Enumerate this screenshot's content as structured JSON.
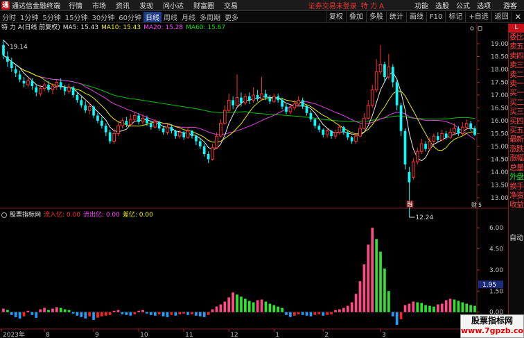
{
  "menubar": {
    "logo": "通",
    "app_title": "通达信金融终端",
    "items": [
      "行情",
      "市场",
      "资讯",
      "发现",
      "问小达",
      "财富圈",
      "交易"
    ],
    "status": "证券交易未登录",
    "stock_name": "特 力 A",
    "right_items": [
      "功能",
      "选股",
      "公式",
      "选项",
      "游客"
    ]
  },
  "toolbar": {
    "periods": [
      "分时",
      "1分钟",
      "5分钟",
      "15分钟",
      "30分钟",
      "60分钟",
      "日线",
      "周线",
      "月线",
      "多周期",
      "更多"
    ],
    "active_period": "日线",
    "tools": [
      "复权",
      "叠加",
      "多股",
      "统计",
      "画线",
      "F10",
      "标记",
      "+自选",
      "返回"
    ],
    "close": "✕"
  },
  "main_chart": {
    "title": "特 力 A(日线 前复权)",
    "ma5": "MA5: 15.43",
    "ma10": "MA10: 15.43",
    "ma20": "MA20: 15.28",
    "ma60": "MA60: 15.67",
    "high_label": "19.14",
    "low_label": "12.24",
    "axis_ticks": [
      "19.00",
      "18.50",
      "18.00",
      "17.50",
      "17.00",
      "16.50",
      "16.00",
      "15.50",
      "15.00",
      "14.50",
      "14.00",
      "13.50",
      "13.00"
    ],
    "badge_liang": "融",
    "badge_cai": "财",
    "badge_num": "5"
  },
  "indicator": {
    "name": "股票指标网",
    "in_label": "流入亿: 0.00",
    "out_label": "流出亿: 0.00",
    "diff_label": "差亿: 0.00",
    "axis_ticks": [
      "6.00",
      "4.50",
      "3.00",
      "1.50",
      "0.00"
    ],
    "current_value": "1.95"
  },
  "x_axis": {
    "labels": [
      "2023年",
      "8",
      "9",
      "10",
      "11",
      "12",
      "1",
      "2",
      "3"
    ]
  },
  "side_panel": {
    "tab": "L",
    "items": [
      "委比",
      "卖五",
      "卖四",
      "卖三",
      "卖二",
      "卖一",
      "买一",
      "买二",
      "买三",
      "买四",
      "买五",
      "最新",
      "涨跌",
      "涨幅",
      "总量",
      "外盘",
      "换手",
      "净资",
      "收益"
    ],
    "green_items": [
      "外盘"
    ],
    "indicator_label": "自动"
  },
  "watermark": {
    "title": "股票指标网",
    "url": "www.7gpzb.com"
  },
  "chart_data": {
    "type": "candlestick",
    "price_axis_range": [
      12.7,
      19.35
    ],
    "indicator_axis_range": [
      -1.0,
      6.6
    ],
    "candles": [
      {
        "o": 18.95,
        "c": 18.55,
        "h": 19.14,
        "l": 18.4
      },
      {
        "o": 18.5,
        "c": 18.3,
        "h": 18.7,
        "l": 18.1
      },
      {
        "o": 18.3,
        "c": 18.05,
        "h": 18.45,
        "l": 17.9
      },
      {
        "o": 18.0,
        "c": 17.85,
        "h": 18.15,
        "l": 17.7
      },
      {
        "o": 17.8,
        "c": 17.6,
        "h": 17.95,
        "l": 17.5
      },
      {
        "o": 17.55,
        "c": 17.45,
        "h": 17.7,
        "l": 17.3
      },
      {
        "o": 17.4,
        "c": 17.55,
        "h": 17.7,
        "l": 17.3
      },
      {
        "o": 17.55,
        "c": 17.35,
        "h": 17.65,
        "l": 17.2
      },
      {
        "o": 17.3,
        "c": 17.1,
        "h": 17.4,
        "l": 16.95
      },
      {
        "o": 17.05,
        "c": 17.25,
        "h": 17.4,
        "l": 16.95
      },
      {
        "o": 17.25,
        "c": 17.4,
        "h": 17.5,
        "l": 17.15
      },
      {
        "o": 17.4,
        "c": 17.2,
        "h": 17.55,
        "l": 17.1
      },
      {
        "o": 17.2,
        "c": 17.35,
        "h": 17.45,
        "l": 17.05
      },
      {
        "o": 17.35,
        "c": 17.5,
        "h": 17.6,
        "l": 17.2
      },
      {
        "o": 17.5,
        "c": 17.3,
        "h": 17.65,
        "l": 17.2
      },
      {
        "o": 17.3,
        "c": 17.15,
        "h": 17.4,
        "l": 17.0
      },
      {
        "o": 17.15,
        "c": 17.3,
        "h": 17.45,
        "l": 17.05
      },
      {
        "o": 17.3,
        "c": 17.0,
        "h": 17.35,
        "l": 16.9
      },
      {
        "o": 17.0,
        "c": 16.8,
        "h": 17.1,
        "l": 16.7
      },
      {
        "o": 16.8,
        "c": 16.6,
        "h": 16.95,
        "l": 16.5
      },
      {
        "o": 16.6,
        "c": 16.4,
        "h": 16.75,
        "l": 16.3
      },
      {
        "o": 16.4,
        "c": 16.55,
        "h": 16.7,
        "l": 16.25
      },
      {
        "o": 16.55,
        "c": 16.2,
        "h": 16.6,
        "l": 16.1
      },
      {
        "o": 16.2,
        "c": 16.0,
        "h": 16.3,
        "l": 15.9
      },
      {
        "o": 16.0,
        "c": 15.8,
        "h": 16.15,
        "l": 15.7
      },
      {
        "o": 15.8,
        "c": 15.55,
        "h": 15.9,
        "l": 15.4
      },
      {
        "o": 15.55,
        "c": 15.2,
        "h": 15.65,
        "l": 15.1
      },
      {
        "o": 15.2,
        "c": 15.5,
        "h": 15.7,
        "l": 15.1
      },
      {
        "o": 15.5,
        "c": 15.8,
        "h": 15.95,
        "l": 15.4
      },
      {
        "o": 15.8,
        "c": 16.0,
        "h": 16.1,
        "l": 15.7
      },
      {
        "o": 16.0,
        "c": 15.85,
        "h": 16.15,
        "l": 15.75
      },
      {
        "o": 15.85,
        "c": 16.05,
        "h": 16.25,
        "l": 15.8
      },
      {
        "o": 16.05,
        "c": 16.2,
        "h": 16.35,
        "l": 15.95
      },
      {
        "o": 16.2,
        "c": 15.95,
        "h": 16.3,
        "l": 15.85
      },
      {
        "o": 15.95,
        "c": 16.1,
        "h": 16.25,
        "l": 15.85
      },
      {
        "o": 16.1,
        "c": 15.9,
        "h": 16.2,
        "l": 15.8
      },
      {
        "o": 15.9,
        "c": 15.75,
        "h": 16.0,
        "l": 15.65
      },
      {
        "o": 15.75,
        "c": 15.95,
        "h": 16.05,
        "l": 15.7
      },
      {
        "o": 15.95,
        "c": 15.7,
        "h": 16.0,
        "l": 15.6
      },
      {
        "o": 15.7,
        "c": 15.55,
        "h": 15.8,
        "l": 15.45
      },
      {
        "o": 15.55,
        "c": 15.75,
        "h": 15.85,
        "l": 15.45
      },
      {
        "o": 15.75,
        "c": 15.6,
        "h": 15.85,
        "l": 15.5
      },
      {
        "o": 15.6,
        "c": 15.4,
        "h": 15.65,
        "l": 15.3
      },
      {
        "o": 15.4,
        "c": 15.55,
        "h": 15.65,
        "l": 15.3
      },
      {
        "o": 15.55,
        "c": 15.35,
        "h": 15.6,
        "l": 15.25
      },
      {
        "o": 15.35,
        "c": 15.6,
        "h": 15.75,
        "l": 15.3
      },
      {
        "o": 15.6,
        "c": 15.4,
        "h": 15.65,
        "l": 15.3
      },
      {
        "o": 15.4,
        "c": 15.2,
        "h": 15.45,
        "l": 15.05
      },
      {
        "o": 15.2,
        "c": 15.0,
        "h": 15.3,
        "l": 14.9
      },
      {
        "o": 15.0,
        "c": 14.7,
        "h": 15.1,
        "l": 14.6
      },
      {
        "o": 14.7,
        "c": 14.5,
        "h": 14.8,
        "l": 14.35
      },
      {
        "o": 14.5,
        "c": 14.95,
        "h": 15.1,
        "l": 14.45
      },
      {
        "o": 14.95,
        "c": 15.4,
        "h": 15.55,
        "l": 14.9
      },
      {
        "o": 15.4,
        "c": 15.9,
        "h": 16.05,
        "l": 15.35
      },
      {
        "o": 15.9,
        "c": 16.4,
        "h": 16.6,
        "l": 15.85
      },
      {
        "o": 16.4,
        "c": 16.8,
        "h": 17.05,
        "l": 16.3
      },
      {
        "o": 16.8,
        "c": 16.6,
        "h": 16.95,
        "l": 16.45
      },
      {
        "o": 16.6,
        "c": 16.9,
        "h": 17.8,
        "l": 16.55
      },
      {
        "o": 16.9,
        "c": 16.7,
        "h": 17.1,
        "l": 16.55
      },
      {
        "o": 16.7,
        "c": 16.95,
        "h": 17.05,
        "l": 16.6
      },
      {
        "o": 16.95,
        "c": 16.8,
        "h": 17.1,
        "l": 16.65
      },
      {
        "o": 16.8,
        "c": 17.0,
        "h": 17.3,
        "l": 16.7
      },
      {
        "o": 17.0,
        "c": 16.85,
        "h": 17.2,
        "l": 16.75
      },
      {
        "o": 16.85,
        "c": 17.05,
        "h": 17.7,
        "l": 16.8
      },
      {
        "o": 17.05,
        "c": 16.9,
        "h": 17.2,
        "l": 16.8
      },
      {
        "o": 16.9,
        "c": 16.75,
        "h": 17.0,
        "l": 16.65
      },
      {
        "o": 16.75,
        "c": 16.95,
        "h": 17.05,
        "l": 16.7
      },
      {
        "o": 16.95,
        "c": 16.8,
        "h": 17.05,
        "l": 16.7
      },
      {
        "o": 16.8,
        "c": 16.55,
        "h": 16.9,
        "l": 16.45
      },
      {
        "o": 16.55,
        "c": 16.35,
        "h": 16.65,
        "l": 16.25
      },
      {
        "o": 16.35,
        "c": 16.5,
        "h": 16.6,
        "l": 16.25
      },
      {
        "o": 16.5,
        "c": 16.65,
        "h": 16.8,
        "l": 16.4
      },
      {
        "o": 16.65,
        "c": 16.8,
        "h": 16.95,
        "l": 16.55
      },
      {
        "o": 16.8,
        "c": 16.55,
        "h": 16.9,
        "l": 16.45
      },
      {
        "o": 16.55,
        "c": 16.3,
        "h": 16.6,
        "l": 16.2
      },
      {
        "o": 16.3,
        "c": 16.05,
        "h": 16.4,
        "l": 15.95
      },
      {
        "o": 16.05,
        "c": 15.8,
        "h": 16.1,
        "l": 15.7
      },
      {
        "o": 15.8,
        "c": 15.65,
        "h": 15.9,
        "l": 15.55
      },
      {
        "o": 15.65,
        "c": 15.45,
        "h": 15.7,
        "l": 15.35
      },
      {
        "o": 15.45,
        "c": 15.6,
        "h": 15.7,
        "l": 15.35
      },
      {
        "o": 15.6,
        "c": 15.4,
        "h": 15.65,
        "l": 15.3
      },
      {
        "o": 15.4,
        "c": 15.55,
        "h": 15.65,
        "l": 15.3
      },
      {
        "o": 15.55,
        "c": 15.75,
        "h": 15.85,
        "l": 15.45
      },
      {
        "o": 15.75,
        "c": 15.55,
        "h": 15.8,
        "l": 15.45
      },
      {
        "o": 15.55,
        "c": 15.35,
        "h": 15.6,
        "l": 15.25
      },
      {
        "o": 15.35,
        "c": 15.2,
        "h": 15.4,
        "l": 15.1
      },
      {
        "o": 15.2,
        "c": 15.4,
        "h": 15.5,
        "l": 15.1
      },
      {
        "o": 15.4,
        "c": 15.7,
        "h": 15.85,
        "l": 15.35
      },
      {
        "o": 15.7,
        "c": 16.1,
        "h": 16.3,
        "l": 15.65
      },
      {
        "o": 16.1,
        "c": 16.6,
        "h": 16.8,
        "l": 16.05
      },
      {
        "o": 16.6,
        "c": 17.2,
        "h": 17.4,
        "l": 16.5
      },
      {
        "o": 17.2,
        "c": 17.9,
        "h": 18.4,
        "l": 17.1
      },
      {
        "o": 17.9,
        "c": 18.2,
        "h": 18.95,
        "l": 17.8
      },
      {
        "o": 18.2,
        "c": 17.7,
        "h": 18.3,
        "l": 17.5
      },
      {
        "o": 17.7,
        "c": 18.1,
        "h": 18.6,
        "l": 17.6
      },
      {
        "o": 18.1,
        "c": 17.5,
        "h": 18.2,
        "l": 17.3
      },
      {
        "o": 17.5,
        "c": 16.6,
        "h": 17.6,
        "l": 16.4
      },
      {
        "o": 16.6,
        "c": 15.6,
        "h": 16.7,
        "l": 15.4
      },
      {
        "o": 15.6,
        "c": 14.3,
        "h": 15.7,
        "l": 14.1
      },
      {
        "o": 14.0,
        "c": 13.6,
        "h": 14.2,
        "l": 12.24
      },
      {
        "o": 13.8,
        "c": 14.4,
        "h": 14.55,
        "l": 13.7
      },
      {
        "o": 14.4,
        "c": 14.8,
        "h": 14.95,
        "l": 14.3
      },
      {
        "o": 14.8,
        "c": 15.1,
        "h": 15.3,
        "l": 14.7
      },
      {
        "o": 15.1,
        "c": 14.9,
        "h": 15.2,
        "l": 14.8
      },
      {
        "o": 14.9,
        "c": 15.2,
        "h": 15.35,
        "l": 14.85
      },
      {
        "o": 15.2,
        "c": 15.4,
        "h": 15.5,
        "l": 15.1
      },
      {
        "o": 15.4,
        "c": 15.25,
        "h": 15.55,
        "l": 15.15
      },
      {
        "o": 15.25,
        "c": 15.5,
        "h": 15.65,
        "l": 15.2
      },
      {
        "o": 15.5,
        "c": 15.35,
        "h": 15.6,
        "l": 15.25
      },
      {
        "o": 15.35,
        "c": 15.55,
        "h": 15.7,
        "l": 15.3
      },
      {
        "o": 15.55,
        "c": 15.7,
        "h": 15.9,
        "l": 15.45
      },
      {
        "o": 15.7,
        "c": 15.5,
        "h": 15.8,
        "l": 15.4
      },
      {
        "o": 15.5,
        "c": 15.75,
        "h": 15.95,
        "l": 15.45
      },
      {
        "o": 15.75,
        "c": 15.9,
        "h": 16.05,
        "l": 15.65
      },
      {
        "o": 15.9,
        "c": 15.7,
        "h": 16.0,
        "l": 15.6
      },
      {
        "o": 15.7,
        "c": 15.45,
        "h": 15.8,
        "l": 15.4
      }
    ],
    "indicator_values": [
      0.25,
      0.15,
      -0.2,
      -0.35,
      -0.45,
      -0.3,
      0.1,
      -0.2,
      -0.4,
      0.2,
      0.3,
      0.15,
      0.25,
      0.35,
      0.3,
      0.2,
      0.15,
      -0.1,
      -0.25,
      -0.35,
      -0.45,
      -0.3,
      -0.55,
      -0.4,
      -0.3,
      -0.25,
      -0.2,
      0.1,
      0.15,
      -0.15,
      -0.2,
      -0.25,
      -0.15,
      0.1,
      0.15,
      -0.1,
      -0.2,
      -0.25,
      -0.15,
      -0.3,
      -0.35,
      -0.2,
      -0.25,
      -0.15,
      -0.1,
      -0.2,
      -0.15,
      -0.25,
      -0.3,
      -0.35,
      -0.2,
      0.2,
      0.4,
      0.55,
      0.75,
      1.05,
      1.4,
      1.25,
      1.1,
      0.95,
      0.8,
      0.7,
      0.85,
      0.9,
      0.75,
      0.6,
      0.5,
      0.4,
      0.3,
      -0.2,
      -0.35,
      -0.25,
      -0.15,
      -0.2,
      -0.25,
      -0.3,
      -0.2,
      -0.15,
      -0.25,
      -0.2,
      -0.15,
      0.15,
      0.2,
      0.3,
      0.45,
      0.7,
      1.3,
      2.2,
      3.4,
      4.8,
      6.0,
      5.2,
      4.3,
      3.1,
      1.5,
      -0.3,
      -0.9,
      -0.5,
      0.5,
      0.6,
      0.75,
      0.7,
      0.65,
      0.5,
      0.45,
      0.4,
      0.55,
      0.6,
      0.85,
      0.95,
      0.9,
      0.8,
      0.7,
      0.6,
      0.5,
      0.45
    ],
    "x_tick_indices": [
      0,
      10,
      22,
      33,
      44,
      55,
      66,
      78,
      92
    ],
    "grid": false
  }
}
